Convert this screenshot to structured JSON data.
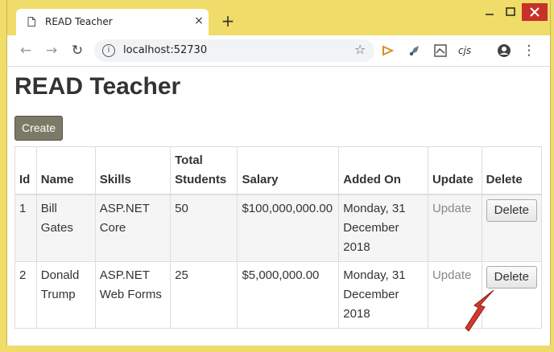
{
  "browser": {
    "tab_title": "READ Teacher",
    "tab_close": "×",
    "new_tab": "+",
    "url": "localhost:52730",
    "back": "←",
    "forward": "→",
    "reload": "↻",
    "star": "☆",
    "ext_cjs": "cjs",
    "menu": "⋮",
    "info": "i"
  },
  "page": {
    "title": "READ Teacher",
    "create_label": "Create"
  },
  "table": {
    "headers": [
      "Id",
      "Name",
      "Skills",
      "Total Students",
      "Salary",
      "Added On",
      "Update",
      "Delete"
    ],
    "rows": [
      {
        "id": "1",
        "name": "Bill Gates",
        "skills": "ASP.NET Core",
        "total_students": "50",
        "salary": "$100,000,000.00",
        "added_on": "Monday, 31 December 2018",
        "update": "Update",
        "delete": "Delete"
      },
      {
        "id": "2",
        "name": "Donald Trump",
        "skills": "ASP.NET Web Forms",
        "total_students": "25",
        "salary": "$5,000,000.00",
        "added_on": "Monday, 31 December 2018",
        "update": "Update",
        "delete": "Delete"
      }
    ]
  },
  "colors": {
    "frame": "#f0dc68",
    "create_button": "#7a7a66",
    "close_window": "#c8302a",
    "arrow": "#d23a2e"
  }
}
